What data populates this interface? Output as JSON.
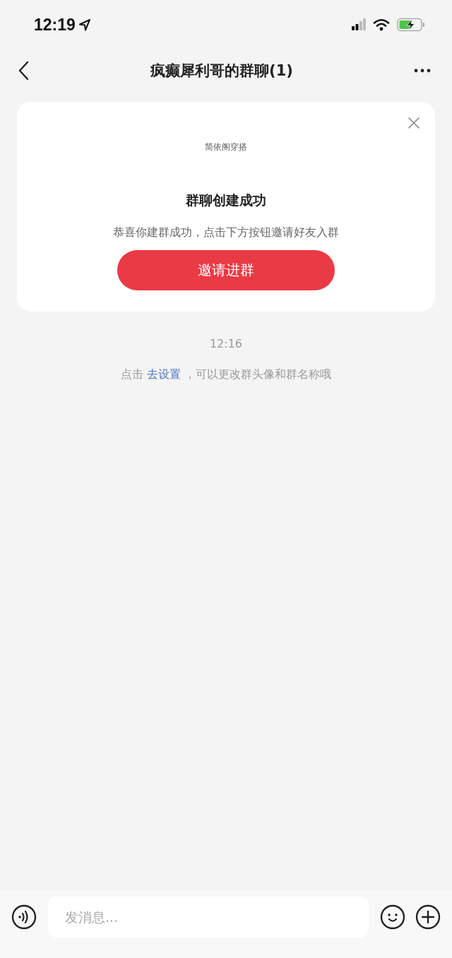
{
  "status_bar": {
    "time": "12:19"
  },
  "nav": {
    "title": "疯癫犀利哥的群聊(1)"
  },
  "card": {
    "group_name": "简依阁穿搭",
    "heading": "群聊创建成功",
    "message": "恭喜你建群成功，点击下方按钮邀请好友入群",
    "button": "邀请进群"
  },
  "messages": [
    {
      "kind": "time",
      "text": "12:16"
    },
    {
      "kind": "notice",
      "before": "点击",
      "link": "去设置",
      "after": "，可以更改群头像和群名称哦"
    }
  ],
  "composer": {
    "placeholder": "发消息..."
  }
}
